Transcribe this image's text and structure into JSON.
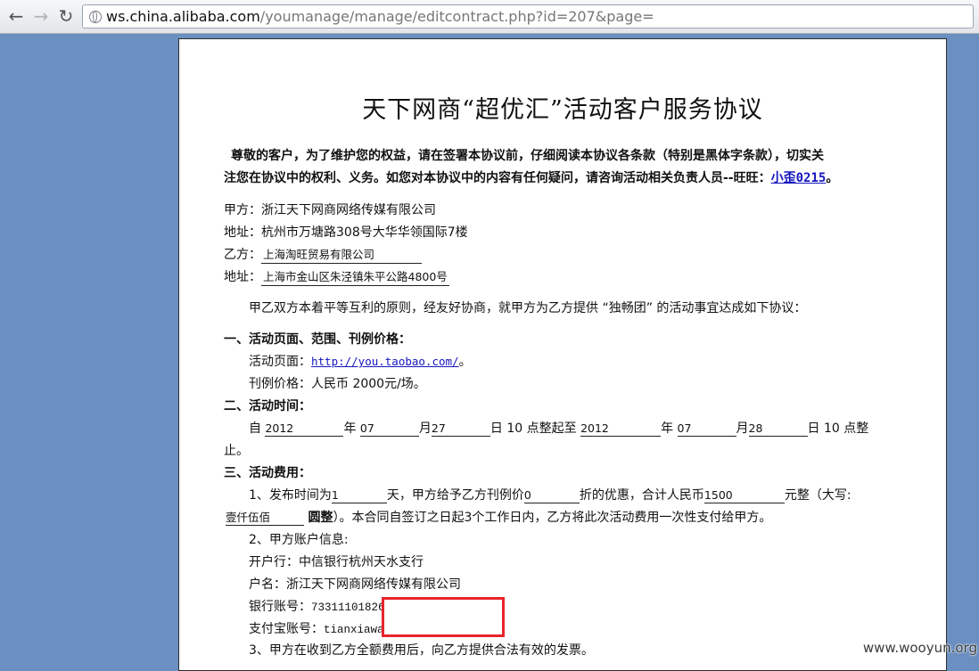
{
  "browser": {
    "url_host": "ws.china.alibaba.com",
    "url_path": "/youmanage/manage/editcontract.php?id=207&page="
  },
  "doc": {
    "title": "天下网商“超优汇”活动客户服务协议",
    "intro_line1": "尊敬的客户，为了维护您的权益，请在签署本协议前，仔细阅读本协议各条款（特别是黑体字条款），切实关",
    "intro_line2_a": "注您在协议中的权利、义务。如您对本协议中的内容有任何疑问，请咨询活动相关负责人员--旺旺：",
    "intro_contact": "小歪0215",
    "intro_line2_end": "。",
    "party_a_label": "甲方：",
    "party_a": "浙江天下网商网络传媒有限公司",
    "address_label": "地址：",
    "party_a_address": "杭州市万塘路308号大华华领国际7楼",
    "party_b_label": "乙方：",
    "party_b": "上海淘旺贸易有限公司",
    "party_b_address": "上海市金山区朱泾镇朱平公路4800号",
    "agreement": "甲乙双方本着平等互利的原则，经友好协商，就甲方为乙方提供 “独畅团” 的活动事宜达成如下协议：",
    "sec1_title": "一、活动页面、范围、刊例价格：",
    "page_label": "活动页面：",
    "page_url": "http://you.taobao.com/",
    "page_end": "。",
    "price_text": "刊例价格：人民币 2000元/场。",
    "sec2_title": "二、活动时间：",
    "time": {
      "from": "自",
      "y1": "2012",
      "year": "年",
      "m1": "07",
      "month": "月",
      "d1": "27",
      "day": "日",
      "h1_text": "10 点整起至",
      "y2": "2012",
      "m2": "07",
      "d2": "28",
      "h2_text": "10 点整",
      "wrap": "止。"
    },
    "sec3_title": "三、活动费用：",
    "fee": {
      "p1": "1、发布时间为",
      "days": "1",
      "p2": "天，甲方给予乙方刊例价",
      "discount": "0",
      "p3": "折的优惠，合计人民币",
      "amount": "1500",
      "p4": "元整（大写:",
      "amount_cn": "壹仟伍佰",
      "yuan": "圆整",
      "p5": "）。本合同自签订之日起3个工作日内，乙方将此次活动费用一次性支付给甲方。"
    },
    "account_title": "2、甲方账户信息:",
    "bank_text": "开户行：中信银行杭州天水支行",
    "account_name": "户名：浙江天下网商网络传媒有限公司",
    "bank_no_label": "银行账号：",
    "bank_no": "73311101826",
    "alipay_label": "支付宝账号：",
    "alipay": "tianxiawa",
    "invoice": "3、甲方在收到乙方全额费用后，向乙方提供合法有效的发票。"
  },
  "watermark": "www.wooyun.org"
}
